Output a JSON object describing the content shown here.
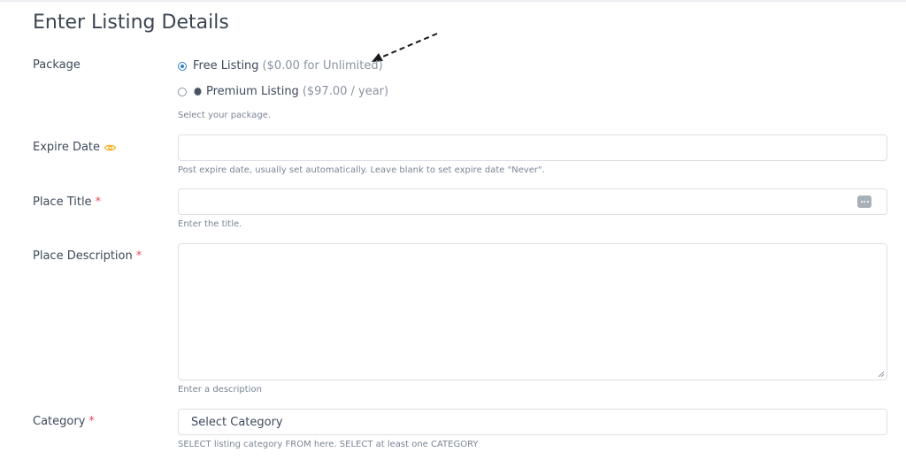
{
  "page": {
    "title": "Enter Listing Details"
  },
  "package": {
    "label": "Package",
    "options": [
      {
        "name": "Free Listing",
        "price": "($0.00 for Unlimited)",
        "checked": true
      },
      {
        "name": "Premium Listing",
        "price": "($97.00 / year)",
        "checked": false,
        "icon": "badge-icon"
      }
    ],
    "hint": "Select your package."
  },
  "expire_date": {
    "label": "Expire Date",
    "icon": "eye-icon",
    "icon_color": "#f2b01e",
    "value": "",
    "hint": "Post expire date, usually set automatically. Leave blank to set expire date \"Never\"."
  },
  "place_title": {
    "label": "Place Title",
    "required_mark": "*",
    "value": "",
    "hint": "Enter the title."
  },
  "place_description": {
    "label": "Place Description",
    "required_mark": "*",
    "value": "",
    "hint": "Enter a description"
  },
  "category": {
    "label": "Category",
    "required_mark": "*",
    "selected": "Select Category",
    "hint": "SELECT listing category FROM here. SELECT at least one CATEGORY"
  },
  "colors": {
    "accent": "#2f7fd0",
    "required": "#e34d5a",
    "border": "#dcdfe4"
  }
}
